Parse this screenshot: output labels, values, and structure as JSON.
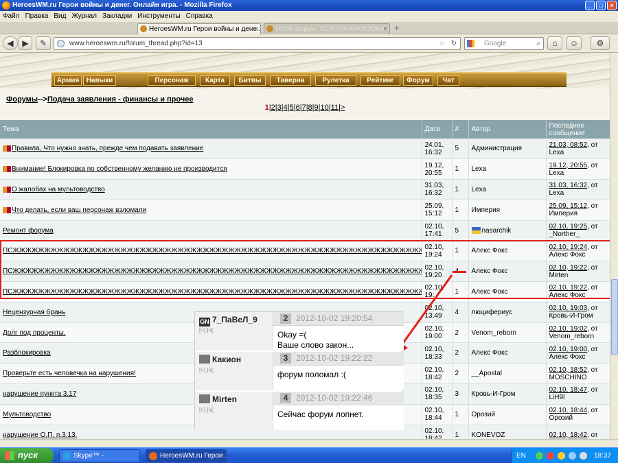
{
  "window": {
    "title": "HeroesWM.ru Герои войны и денег. Онлайн игра. - Mozilla Firefox"
  },
  "menu": [
    "Файл",
    "Правка",
    "Вид",
    "Журнал",
    "Закладки",
    "Инструменты",
    "Справка"
  ],
  "tabs": [
    {
      "label": "HeroesWM.ru Герои войны и дене...",
      "active": true
    },
    {
      "label": "HWM форум: ПСЖЖЖЖЖЖЖЖЖЖЖЖ...",
      "active": false
    }
  ],
  "nav": {
    "url": "www.heroeswm.ru/forum_thread.php?id=13",
    "search_placeholder": "Google",
    "back_icon": "back-arrow-icon",
    "forward_icon": "forward-arrow-icon"
  },
  "game_nav": {
    "left": [
      "Армия",
      "Навыки"
    ],
    "items": [
      "Персонаж",
      "Карта",
      "Битвы",
      "Таверна",
      "Рулетка",
      "Рейтинг",
      "Форум",
      "Чат"
    ]
  },
  "forum": {
    "breadcrumb_root": "Форумы",
    "breadcrumb_sep": "-->",
    "breadcrumb_section": "Подача заявления - финансы и прочее",
    "pager_current": "1",
    "pager_pages": [
      "2",
      "3",
      "4",
      "5",
      "6",
      "7",
      "8",
      "9",
      "10",
      "11"
    ],
    "pager_next": ">"
  },
  "table": {
    "headers": [
      "Тема",
      "Дата",
      "#",
      "Автор",
      "Последнее сообщение"
    ],
    "rows": [
      {
        "topic": "Правила, Что нужно знать, прежде чем подавать заявление",
        "icons": true,
        "date": "24.01, 16:32",
        "count": "5",
        "author": "Администрация",
        "last_date": "21.03, 08:52",
        "last_by": "Lexa"
      },
      {
        "topic": "Внимание! Блокировка по собственному желанию не производится",
        "icons": true,
        "date": "19.12, 20:55",
        "count": "1",
        "author": "Lexa",
        "last_date": "19.12, 20:55",
        "last_by": "Lexa"
      },
      {
        "topic": "О жалобах на мультоводство",
        "icons": true,
        "date": "31.03, 16:32",
        "count": "1",
        "author": "Lexa",
        "last_date": "31.03, 16:32",
        "last_by": "Lexa"
      },
      {
        "topic": "Что делать, если ваш персонаж взломали",
        "icons": true,
        "date": "25.09, 15:12",
        "count": "1",
        "author": "Империя",
        "last_date": "25.09, 15:12",
        "last_by": "Империя"
      },
      {
        "topic": "Ремонт форума",
        "icons": false,
        "date": "02.10, 17:41",
        "count": "5",
        "author": "nasarchik",
        "author_flag": true,
        "last_date": "02.10, 19:25",
        "last_by": "_Norther_"
      },
      {
        "topic": "ПСЖЖЖЖЖЖЖЖЖЖЖЖЖЖЖЖЖЖЖЖЖЖЖЖЖЖЖЖЖЖЖЖЖЖЖЖЖЖЖЖЖЖЖЖЖЖЖЖЖЖЖЖЖЖЖЖЖЖЖЖЖЖЖЖЖЖЖЖЖЖЖЖЖЖЖЖЖЖЖЖЖЖЖЖЖЖЖЖЖЖЖЖЖЖЖЖЖЖЖЖЖЖЖЖЖЖЖЖЖ",
        "icons": false,
        "date": "02.10, 19:24",
        "count": "1",
        "author": "Алекс Фокс",
        "last_date": "02.10, 19:24",
        "last_by": "Алекс Фокс"
      },
      {
        "topic": "ПСЖЖЖЖЖЖЖЖЖЖЖЖЖЖЖЖЖЖЖЖЖЖЖЖЖЖЖЖЖЖЖЖЖЖЖЖЖЖЖЖЖЖЖЖЖЖЖЖЖЖЖЖЖЖЖЖЖЖЖЖЖЖЖЖЖЖЖЖЖЖЖЖЖЖЖЖЖЖЖЖЖЖЖЖЖЖЖЖЖЖЖЖЖЖЖЖЖЖЖЖЖЖЖЖЖЖЖЖЖ",
        "icons": false,
        "date": "02.10, 19:20",
        "count": "4",
        "author": "Алекс Фокс",
        "last_date": "02.10, 19:22",
        "last_by": "Mirten"
      },
      {
        "topic": "ПСЖЖЖЖЖЖЖЖЖЖЖЖЖЖЖЖЖЖЖЖЖЖЖЖЖЖЖЖЖЖЖЖЖЖЖЖЖЖЖЖЖЖЖЖЖЖЖЖЖЖЖЖЖЖЖЖЖЖЖЖЖЖЖЖЖЖЖЖЖЖЖЖЖЖЖЖЖЖЖЖЖЖЖЖЖЖЖЖЖЖЖЖЖЖЖЖЖЖЖЖЖЖЖЖЖЖЖЖЖ",
        "icons": false,
        "date": "02.10, 19:",
        "count": "1",
        "author": "Алекс Фокс",
        "last_date": "02.10, 19:22",
        "last_by": "Алекс Фокс"
      },
      {
        "topic": "Нецензурная брань",
        "icons": false,
        "date": "02.10, 13:49",
        "count": "4",
        "author": "люцифериус",
        "last_date": "02.10, 19:03",
        "last_by": "Кровь-И-Гром"
      },
      {
        "topic": "Долг под проценты.",
        "icons": false,
        "date": "02.10, 19:00",
        "count": "2",
        "author": "Venom_reborn",
        "last_date": "02.10, 19:02",
        "last_by": "Venom_reborn"
      },
      {
        "topic": "Разблокировка",
        "icons": false,
        "date": "02.10, 18:33",
        "count": "2",
        "author": "Алекс Фокс",
        "last_date": "02.10, 19:00",
        "last_by": "Алекс Фокс"
      },
      {
        "topic": "Проверьте есть человечка на нарушения!",
        "icons": false,
        "date": "02.10, 18:42",
        "count": "2",
        "author": "__Apostal",
        "last_date": "02.10, 18:52",
        "last_by": "MOSCHINO"
      },
      {
        "topic": "нарушение пункта 3.17",
        "icons": false,
        "date": "02.10, 18:35",
        "count": "3",
        "author": "Кровь-И-Гром",
        "last_date": "02.10, 18:47",
        "last_by": "LiH9l"
      },
      {
        "topic": "Мультоводство",
        "icons": false,
        "date": "02.10, 18:44",
        "count": "1",
        "author": "Орозий",
        "last_date": "02.10, 18:44",
        "last_by": "Орозий"
      },
      {
        "topic": "нарушение О.П. п.3.13.",
        "icons": false,
        "date": "02.10, 18:42",
        "count": "1",
        "author": "KONEVOZ",
        "last_date": "02.10, 18:42",
        "last_by": ""
      }
    ],
    "last_sep": ", от"
  },
  "popup": {
    "posts": [
      {
        "author": "7_ПаВеЛ_9",
        "badge": "GN",
        "num": "2",
        "date": "2012-10-02 19:20:54",
        "text1": "Okay =(",
        "text2": "Ваше слово закон..."
      },
      {
        "author": "Какион",
        "badge": "",
        "num": "3",
        "date": "2012-10-02 19:22:22",
        "text1": "форум поломал :(",
        "text2": ""
      },
      {
        "author": "Mirten",
        "badge": "",
        "num": "4",
        "date": "2012-10-02 19:22:46",
        "text1": "Сейчас форум лопнет.",
        "text2": ""
      }
    ],
    "small": "[>] [ч]"
  },
  "taskbar": {
    "start": "пуск",
    "items": [
      "Skype™ -",
      "HeroesWM.ru Герои ..."
    ],
    "lang": "EN",
    "clock": "18:37"
  },
  "colors": {
    "accent": "#e0201a",
    "table_header": "#8aa4ab",
    "game_gold": "#b07a1e"
  }
}
